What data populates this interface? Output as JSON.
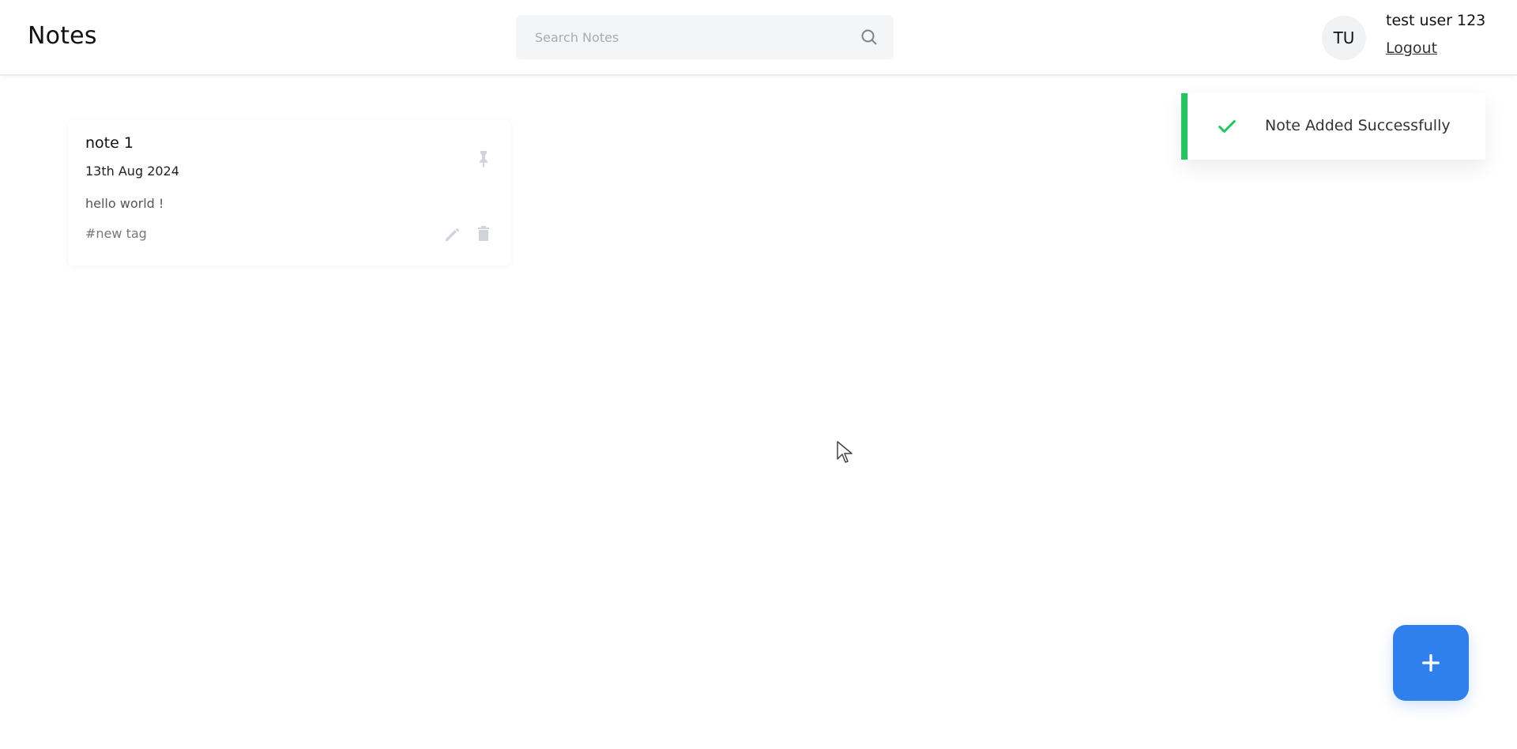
{
  "header": {
    "title": "Notes",
    "search": {
      "placeholder": "Search Notes",
      "value": "",
      "icon": "search-icon"
    },
    "user": {
      "initials": "TU",
      "name": "test user 123",
      "logout_label": "Logout"
    }
  },
  "notes": [
    {
      "title": "note 1",
      "date": "13th Aug 2024",
      "content": "hello world !",
      "tags": "#new tag",
      "pinned": false,
      "icons": {
        "pin": "pin-icon",
        "edit": "edit-icon",
        "delete": "delete-icon"
      }
    }
  ],
  "toast": {
    "message": "Note Added Successfully",
    "status": "success",
    "icon": "check-icon",
    "accent_color": "#22c55e"
  },
  "fab": {
    "icon": "plus-icon",
    "color": "#2f80ed"
  },
  "colors": {
    "accent": "#2f80ed",
    "success": "#22c55e",
    "text": "#111111",
    "muted": "#777777"
  }
}
